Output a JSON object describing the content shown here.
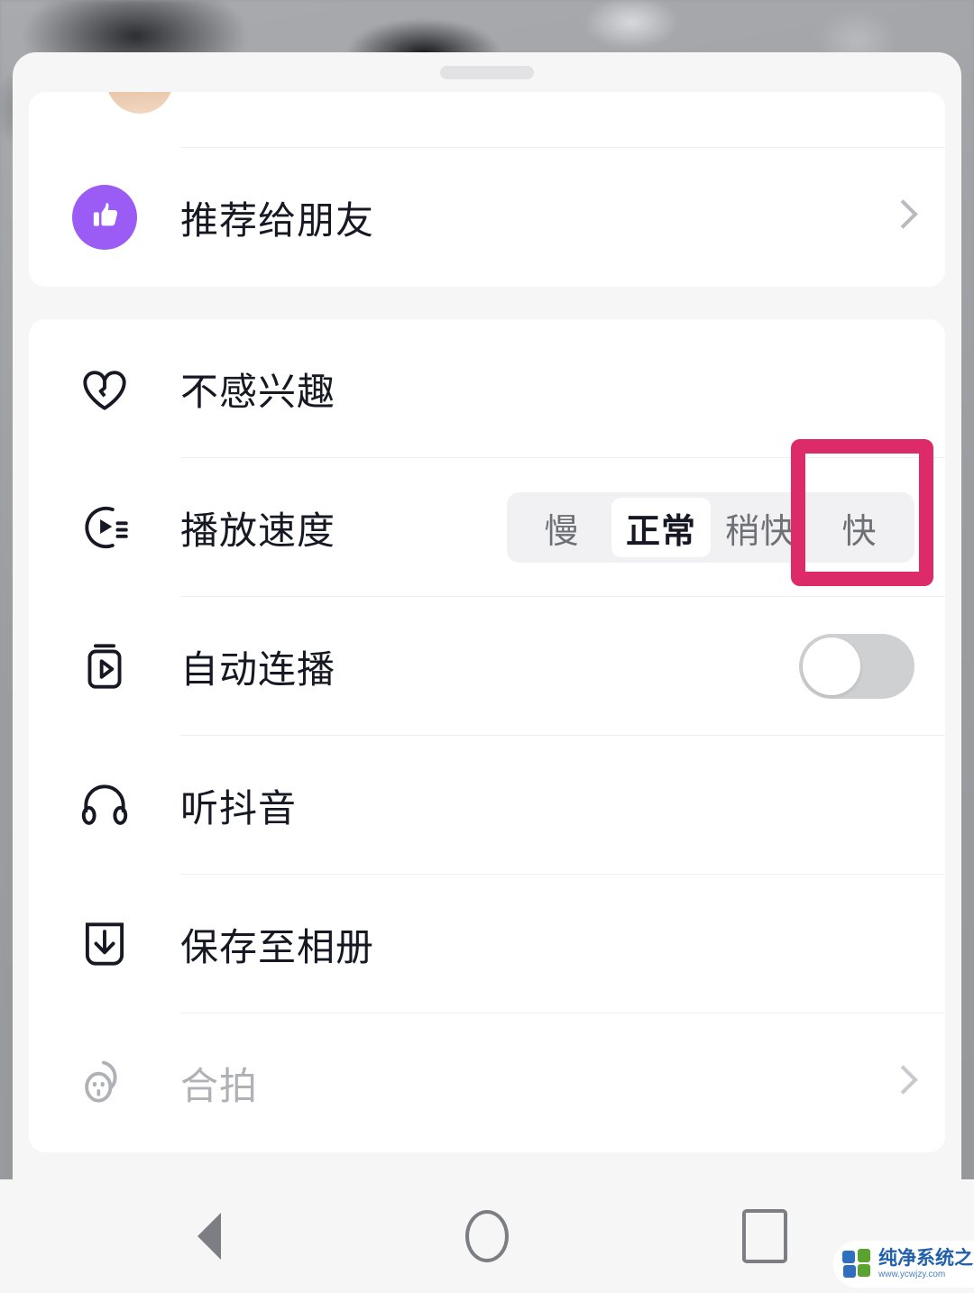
{
  "app": {
    "sheet_title": "",
    "drag_handle": "drag-handle"
  },
  "cards": [
    {
      "rows": [
        {
          "id": "recommend-to-friends",
          "icon": "thumbs-up-icon",
          "label": "推荐给朋友",
          "accessory": "chevron",
          "disabled": false
        }
      ]
    },
    {
      "rows": [
        {
          "id": "not-interested",
          "icon": "broken-heart-icon",
          "label": "不感兴趣",
          "accessory": "none",
          "disabled": false
        },
        {
          "id": "playback-speed",
          "icon": "play-speed-icon",
          "label": "播放速度",
          "accessory": "segmented",
          "disabled": false
        },
        {
          "id": "auto-play-next",
          "icon": "auto-play-icon",
          "label": "自动连播",
          "accessory": "toggle",
          "disabled": false
        },
        {
          "id": "listen-douyin",
          "icon": "headphones-icon",
          "label": "听抖音",
          "accessory": "none",
          "disabled": false
        },
        {
          "id": "save-to-album",
          "icon": "download-icon",
          "label": "保存至相册",
          "accessory": "none",
          "disabled": false
        },
        {
          "id": "duet",
          "icon": "duet-face-icon",
          "label": "合拍",
          "accessory": "chevron",
          "disabled": true
        }
      ]
    }
  ],
  "speed_control": {
    "options": [
      "慢",
      "正常",
      "稍快",
      "快"
    ],
    "selected": "正常",
    "selected_index": 1
  },
  "auto_play_toggle": {
    "state": "off",
    "label": "自动连播"
  },
  "annotation": {
    "type": "highlight-box",
    "target": "快",
    "color": "#dd2a68"
  },
  "navbar": {
    "back": "back-button",
    "home": "home-button",
    "recents": "recents-button"
  },
  "watermark": {
    "title": "纯净系统之家",
    "url": "www.ycwjzy.com"
  },
  "colors": {
    "accent_purple": "#9b5cf6",
    "annotation_pink": "#dd2a68",
    "sheet_bg": "#f6f6f7",
    "card_bg": "#ffffff",
    "segment_track": "#f1f1f3",
    "toggle_off": "#cfd0d2",
    "text_primary": "#161823",
    "text_muted": "#6f7076",
    "text_disabled": "#b0b1b6"
  }
}
